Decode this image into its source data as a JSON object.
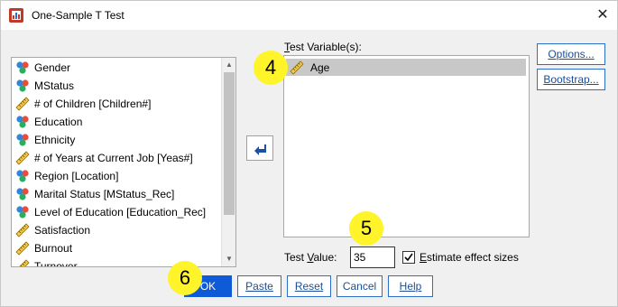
{
  "window": {
    "title": "One-Sample T Test",
    "close_glyph": "✕"
  },
  "variables": [
    {
      "label": "Gender",
      "icon": "nominal-icon"
    },
    {
      "label": "MStatus",
      "icon": "nominal-icon"
    },
    {
      "label": "# of Children [Children#]",
      "icon": "scale-ruler-icon"
    },
    {
      "label": "Education",
      "icon": "nominal-icon"
    },
    {
      "label": "Ethnicity",
      "icon": "nominal-icon"
    },
    {
      "label": "# of Years at Current Job [Yeas#]",
      "icon": "scale-ruler-icon"
    },
    {
      "label": "Region [Location]",
      "icon": "nominal-icon"
    },
    {
      "label": "Marital Status [MStatus_Rec]",
      "icon": "nominal-icon"
    },
    {
      "label": "Level of Education [Education_Rec]",
      "icon": "nominal-icon"
    },
    {
      "label": "Satisfaction",
      "icon": "scale-ruler-icon"
    },
    {
      "label": "Burnout",
      "icon": "scale-ruler-icon"
    },
    {
      "label": "Turnover",
      "icon": "scale-ruler-icon"
    }
  ],
  "test_variables": {
    "label": "Test Variable(s):",
    "items": [
      {
        "label": "Age",
        "icon": "scale-ruler-icon"
      }
    ]
  },
  "side_buttons": {
    "options": "Options...",
    "bootstrap": "Bootstrap..."
  },
  "test_value": {
    "label_pre": "Test ",
    "label_ul": "V",
    "label_post": "alue:",
    "value": "35"
  },
  "effect_sizes": {
    "ul": "E",
    "rest": "stimate effect sizes",
    "checked": true
  },
  "buttons": {
    "ok": "OK",
    "paste": "Paste",
    "reset": "Reset",
    "cancel": "Cancel",
    "help": "Help"
  },
  "annotations": {
    "step4": "4",
    "step5": "5",
    "step6": "6"
  },
  "colors": {
    "accent": "#0f5ad6",
    "badge": "#fff32a"
  }
}
